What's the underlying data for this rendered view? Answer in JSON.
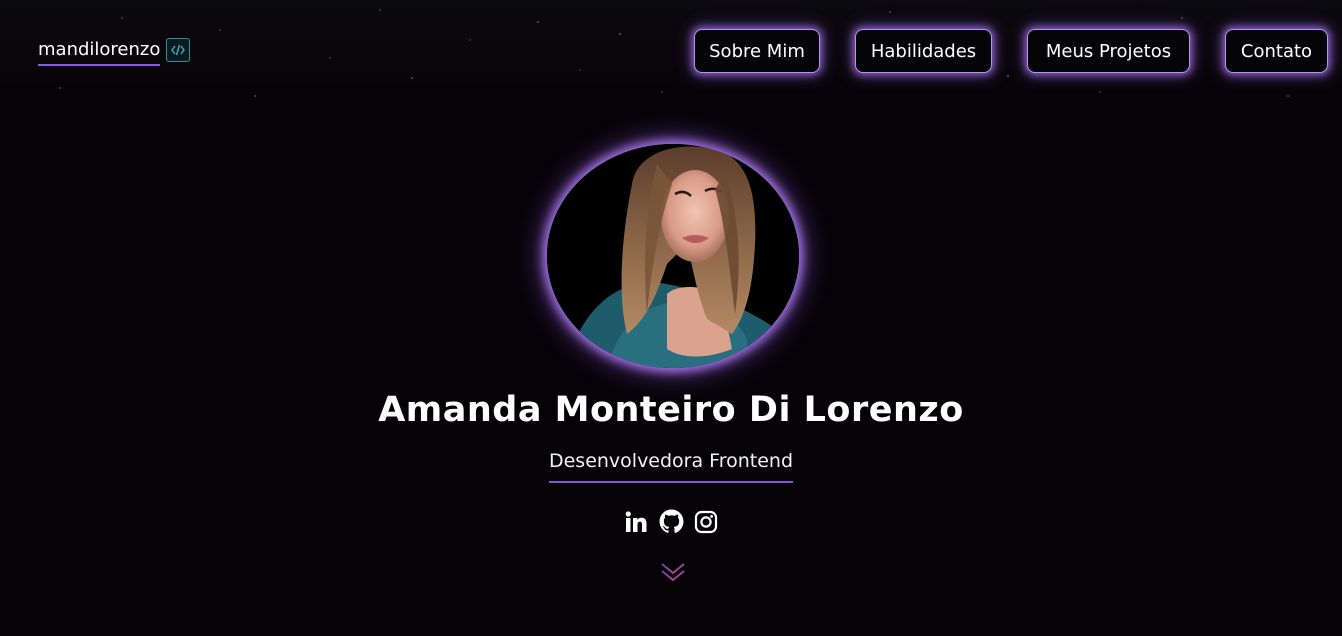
{
  "header": {
    "logo_text": "mandilorenzo",
    "logo_icon": "code-icon",
    "nav": [
      {
        "label": "Sobre Mim"
      },
      {
        "label": "Habilidades"
      },
      {
        "label": "Meus Projetos"
      },
      {
        "label": "Contato"
      }
    ]
  },
  "hero": {
    "name": "Amanda Monteiro Di Lorenzo",
    "role": "Desenvolvedora Frontend",
    "socials": [
      "linkedin-icon",
      "github-icon",
      "instagram-icon"
    ],
    "scroll_icon": "chevron-double-down-icon"
  },
  "colors": {
    "background": "#060307",
    "accent": "#a97cf0",
    "text": "#ffffff"
  }
}
